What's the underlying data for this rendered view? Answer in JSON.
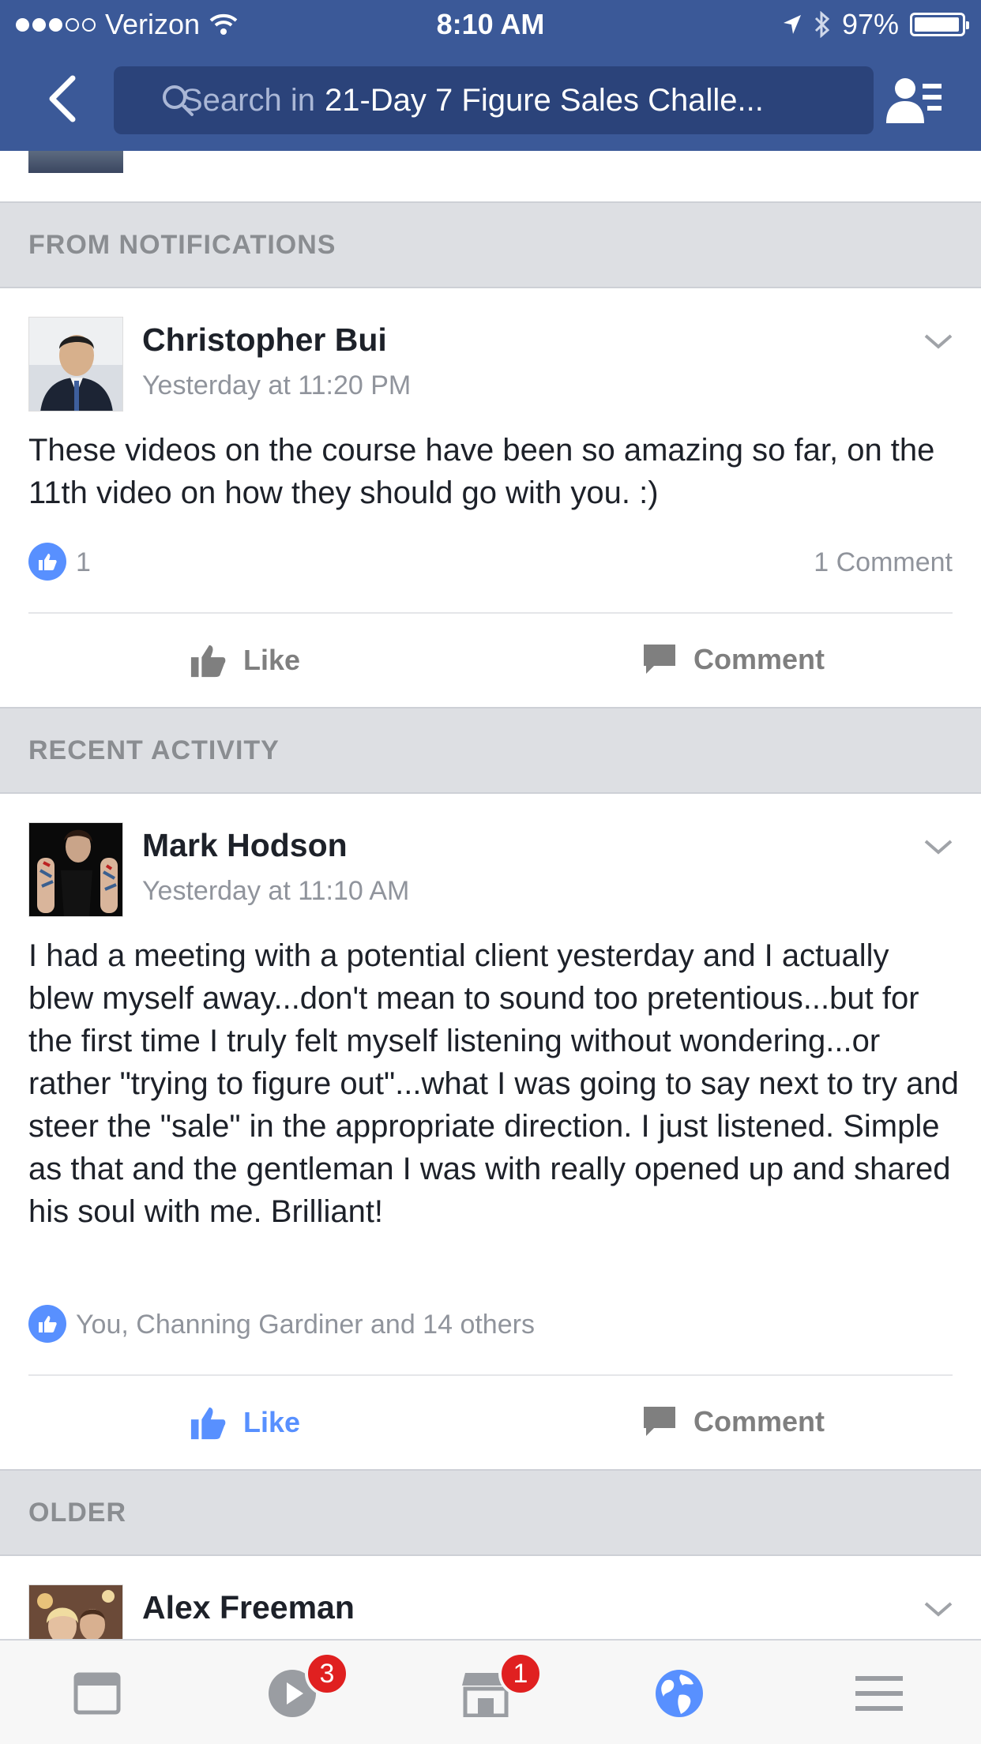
{
  "status_bar": {
    "carrier": "Verizon",
    "time": "8:10 AM",
    "battery": "97%"
  },
  "header": {
    "search_prefix": "Search in",
    "search_group": "21-Day 7 Figure Sales Challe..."
  },
  "sections": {
    "notifications": "FROM NOTIFICATIONS",
    "recent": "RECENT ACTIVITY",
    "older": "OLDER"
  },
  "posts": [
    {
      "author": "Christopher Bui",
      "time": "Yesterday at 11:20 PM",
      "text": "These videos on the course have been so amazing so far, on the 11th video on how they should go with you. :)",
      "likes": "1",
      "comments": "1 Comment",
      "like_label": "Like",
      "comment_label": "Comment"
    },
    {
      "author": "Mark Hodson",
      "time": "Yesterday at 11:10 AM",
      "text": "I had a meeting with a potential client yesterday and I actually blew myself away...don't mean to sound too pretentious...but for the first time I truly felt myself listening without wondering...or rather \"trying to figure out\"...what I was going to say next to try and steer the \"sale\" in the appropriate direction.  I just listened. Simple as that and the gentleman I was with really opened up and shared his soul with me.  Brilliant!",
      "likes": "You, Channing Gardiner and 14 others",
      "like_label": "Like",
      "comment_label": "Comment",
      "liked": true
    },
    {
      "author": "Alex Freeman"
    }
  ],
  "tabbar": {
    "items": [
      {
        "icon": "news-feed-icon"
      },
      {
        "icon": "video-icon",
        "badge": "3"
      },
      {
        "icon": "marketplace-icon",
        "badge": "1"
      },
      {
        "icon": "notifications-globe-icon"
      },
      {
        "icon": "menu-icon"
      }
    ]
  },
  "colors": {
    "brand": "#3b5998",
    "like_blue": "#5890ff",
    "badge_red": "#e02020"
  }
}
